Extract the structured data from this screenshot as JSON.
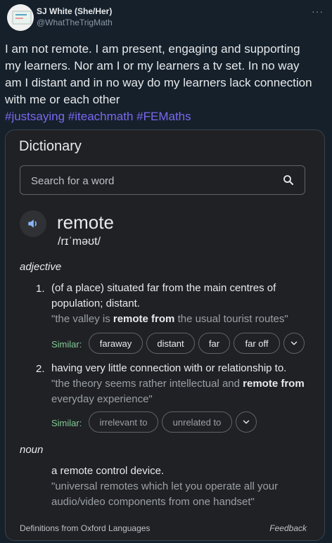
{
  "tweet": {
    "name": "SJ White (She/Her)",
    "handle": "@WhatTheTrigMath",
    "more_icon": "more-horizontal-icon",
    "text": "I am not remote. I am present, engaging and supporting my learners. Nor am I or my learners a tv set. In no way am I distant and in no way do my learners lack connection with me or each other",
    "hashtags": [
      "#justsaying",
      "#iteachmath",
      "#FEMaths"
    ],
    "hashtag_color": "#7b68ee"
  },
  "dictionary": {
    "title": "Dictionary",
    "search_placeholder": "Search for a word",
    "word": "remote",
    "phonetic": "/rɪˈməʊt/",
    "adjective": {
      "label": "adjective",
      "senses": [
        {
          "number": "1.",
          "definition": "(of a place) situated far from the main centres of population; distant.",
          "example_pre": "\"the valley is ",
          "example_bold": "remote from",
          "example_post": " the usual tourist routes\"",
          "similar_label": "Similar:",
          "similar": [
            "faraway",
            "distant",
            "far",
            "far off"
          ]
        },
        {
          "number": "2.",
          "definition": "having very little connection with or relationship to.",
          "example_pre": "\"the theory seems rather intellectual and ",
          "example_bold": "remote from",
          "example_post": " everyday experience\"",
          "similar_label": "Similar:",
          "similar": [
            "irrelevant to",
            "unrelated to"
          ]
        }
      ]
    },
    "noun": {
      "label": "noun",
      "definition": "a remote control device.",
      "example": "\"universal remotes which let you operate all your audio/video components from one handset\""
    },
    "source": "Definitions from Oxford Languages",
    "feedback": "Feedback",
    "accent_green": "#81c995"
  }
}
